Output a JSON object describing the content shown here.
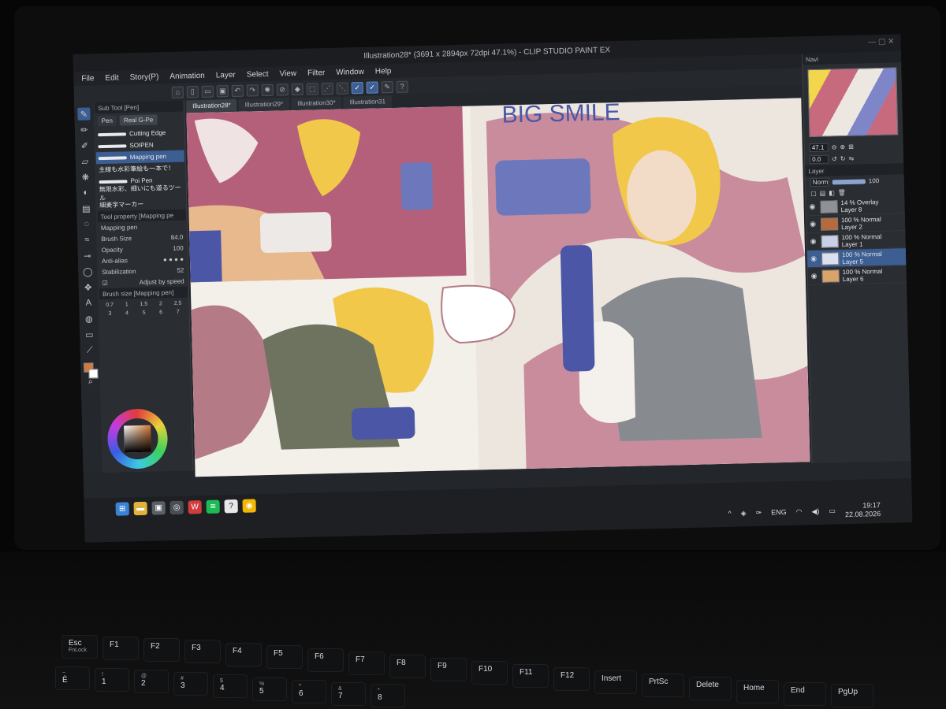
{
  "window": {
    "title": "Illustration28* (3691 x 2894px 72dpi 47.1%) - CLIP STUDIO PAINT EX"
  },
  "menu": [
    "File",
    "Edit",
    "Story(P)",
    "Animation",
    "Layer",
    "Select",
    "View",
    "Filter",
    "Window",
    "Help"
  ],
  "doc_tabs": [
    "Illustration28*",
    "Illustration29*",
    "Illustration30*",
    "Illustration31"
  ],
  "subtool": {
    "header": "Sub Tool [Pen]",
    "tabs": [
      "Pen",
      "Real G-Pe"
    ],
    "brushes": [
      "Cutting Edge",
      "SOIPEN",
      "Mapping pen",
      "主線も水彩筆絵も一本で！",
      "Poi Pen",
      "無限水彩、細いにも道るツール",
      "細麦字マーカー"
    ]
  },
  "tool_property": {
    "header": "Tool property [Mapping pe",
    "brush_name": "Mapping pen",
    "size_label": "Brush Size",
    "size_value": "84.0",
    "opacity_label": "Opacity",
    "opacity_value": "100",
    "antialias_label": "Anti-alias",
    "stabilization_label": "Stabilization",
    "stabilization_value": "52",
    "adjust_label": "Adjust by speed"
  },
  "brush_size": {
    "header": "Brush size [Mapping pen]",
    "values": [
      "0.7",
      "1",
      "1.5",
      "2",
      "2.5",
      "3",
      "4",
      "5",
      "6",
      "7"
    ]
  },
  "colors": {
    "main": "#d47a3a",
    "accent": "#3c5e93"
  },
  "navigator": {
    "tab": "Navi",
    "zoom": "47.1",
    "angle": "0.0"
  },
  "layer_panel": {
    "tab": "Layer",
    "blend_mode": "Norm",
    "opacity": "100",
    "layers": [
      {
        "mode": "14 % Overlay",
        "name": "Layer 8"
      },
      {
        "mode": "100 % Normal",
        "name": "Layer 2"
      },
      {
        "mode": "100 % Normal",
        "name": "Layer 1"
      },
      {
        "mode": "100 % Normal",
        "name": "Layer 5"
      },
      {
        "mode": "100 % Normal",
        "name": "Layer 6"
      }
    ]
  },
  "artwork": {
    "title_text": "BIG SMILE"
  },
  "taskbar": {
    "language": "ENG",
    "time": "19:17",
    "date": "22.08.2026"
  },
  "keyboard": {
    "row1": [
      "Esc",
      "F1",
      "F2",
      "F3",
      "F4",
      "F5",
      "F6",
      "F7",
      "F8",
      "F9",
      "F10",
      "F11",
      "F12",
      "Insert",
      "PrtSc",
      "Delete",
      "Home",
      "End",
      "PgUp"
    ],
    "esc_sub": "FnLock",
    "row2": [
      "Ё",
      "1",
      "2",
      "3",
      "4",
      "5",
      "6",
      "7",
      "8"
    ],
    "row2_top": [
      "~",
      "!",
      "@",
      "#",
      "$",
      "%",
      "^",
      "&",
      "*"
    ]
  }
}
